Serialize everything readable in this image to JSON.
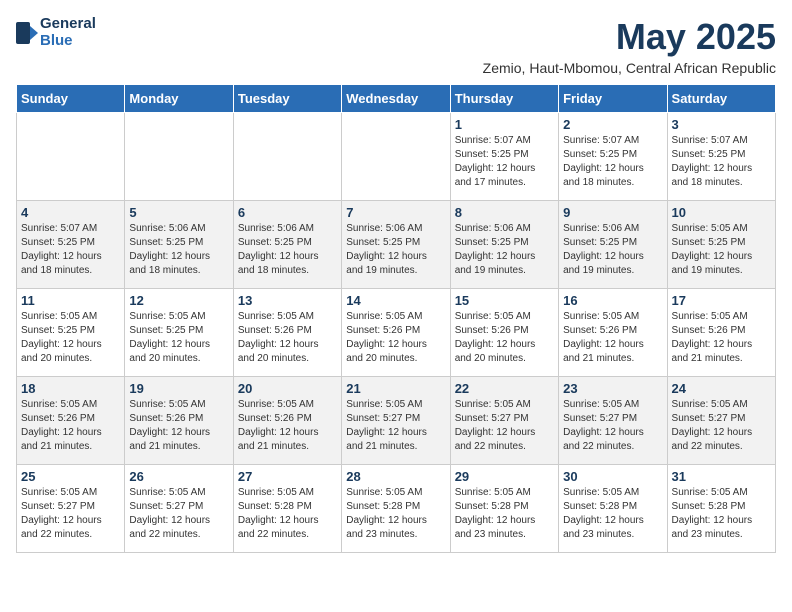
{
  "logo": {
    "line1": "General",
    "line2": "Blue"
  },
  "title": "May 2025",
  "subtitle": "Zemio, Haut-Mbomou, Central African Republic",
  "days_of_week": [
    "Sunday",
    "Monday",
    "Tuesday",
    "Wednesday",
    "Thursday",
    "Friday",
    "Saturday"
  ],
  "weeks": [
    [
      {
        "day": "",
        "info": ""
      },
      {
        "day": "",
        "info": ""
      },
      {
        "day": "",
        "info": ""
      },
      {
        "day": "",
        "info": ""
      },
      {
        "day": "1",
        "info": "Sunrise: 5:07 AM\nSunset: 5:25 PM\nDaylight: 12 hours\nand 17 minutes."
      },
      {
        "day": "2",
        "info": "Sunrise: 5:07 AM\nSunset: 5:25 PM\nDaylight: 12 hours\nand 18 minutes."
      },
      {
        "day": "3",
        "info": "Sunrise: 5:07 AM\nSunset: 5:25 PM\nDaylight: 12 hours\nand 18 minutes."
      }
    ],
    [
      {
        "day": "4",
        "info": "Sunrise: 5:07 AM\nSunset: 5:25 PM\nDaylight: 12 hours\nand 18 minutes."
      },
      {
        "day": "5",
        "info": "Sunrise: 5:06 AM\nSunset: 5:25 PM\nDaylight: 12 hours\nand 18 minutes."
      },
      {
        "day": "6",
        "info": "Sunrise: 5:06 AM\nSunset: 5:25 PM\nDaylight: 12 hours\nand 18 minutes."
      },
      {
        "day": "7",
        "info": "Sunrise: 5:06 AM\nSunset: 5:25 PM\nDaylight: 12 hours\nand 19 minutes."
      },
      {
        "day": "8",
        "info": "Sunrise: 5:06 AM\nSunset: 5:25 PM\nDaylight: 12 hours\nand 19 minutes."
      },
      {
        "day": "9",
        "info": "Sunrise: 5:06 AM\nSunset: 5:25 PM\nDaylight: 12 hours\nand 19 minutes."
      },
      {
        "day": "10",
        "info": "Sunrise: 5:05 AM\nSunset: 5:25 PM\nDaylight: 12 hours\nand 19 minutes."
      }
    ],
    [
      {
        "day": "11",
        "info": "Sunrise: 5:05 AM\nSunset: 5:25 PM\nDaylight: 12 hours\nand 20 minutes."
      },
      {
        "day": "12",
        "info": "Sunrise: 5:05 AM\nSunset: 5:25 PM\nDaylight: 12 hours\nand 20 minutes."
      },
      {
        "day": "13",
        "info": "Sunrise: 5:05 AM\nSunset: 5:26 PM\nDaylight: 12 hours\nand 20 minutes."
      },
      {
        "day": "14",
        "info": "Sunrise: 5:05 AM\nSunset: 5:26 PM\nDaylight: 12 hours\nand 20 minutes."
      },
      {
        "day": "15",
        "info": "Sunrise: 5:05 AM\nSunset: 5:26 PM\nDaylight: 12 hours\nand 20 minutes."
      },
      {
        "day": "16",
        "info": "Sunrise: 5:05 AM\nSunset: 5:26 PM\nDaylight: 12 hours\nand 21 minutes."
      },
      {
        "day": "17",
        "info": "Sunrise: 5:05 AM\nSunset: 5:26 PM\nDaylight: 12 hours\nand 21 minutes."
      }
    ],
    [
      {
        "day": "18",
        "info": "Sunrise: 5:05 AM\nSunset: 5:26 PM\nDaylight: 12 hours\nand 21 minutes."
      },
      {
        "day": "19",
        "info": "Sunrise: 5:05 AM\nSunset: 5:26 PM\nDaylight: 12 hours\nand 21 minutes."
      },
      {
        "day": "20",
        "info": "Sunrise: 5:05 AM\nSunset: 5:26 PM\nDaylight: 12 hours\nand 21 minutes."
      },
      {
        "day": "21",
        "info": "Sunrise: 5:05 AM\nSunset: 5:27 PM\nDaylight: 12 hours\nand 21 minutes."
      },
      {
        "day": "22",
        "info": "Sunrise: 5:05 AM\nSunset: 5:27 PM\nDaylight: 12 hours\nand 22 minutes."
      },
      {
        "day": "23",
        "info": "Sunrise: 5:05 AM\nSunset: 5:27 PM\nDaylight: 12 hours\nand 22 minutes."
      },
      {
        "day": "24",
        "info": "Sunrise: 5:05 AM\nSunset: 5:27 PM\nDaylight: 12 hours\nand 22 minutes."
      }
    ],
    [
      {
        "day": "25",
        "info": "Sunrise: 5:05 AM\nSunset: 5:27 PM\nDaylight: 12 hours\nand 22 minutes."
      },
      {
        "day": "26",
        "info": "Sunrise: 5:05 AM\nSunset: 5:27 PM\nDaylight: 12 hours\nand 22 minutes."
      },
      {
        "day": "27",
        "info": "Sunrise: 5:05 AM\nSunset: 5:28 PM\nDaylight: 12 hours\nand 22 minutes."
      },
      {
        "day": "28",
        "info": "Sunrise: 5:05 AM\nSunset: 5:28 PM\nDaylight: 12 hours\nand 23 minutes."
      },
      {
        "day": "29",
        "info": "Sunrise: 5:05 AM\nSunset: 5:28 PM\nDaylight: 12 hours\nand 23 minutes."
      },
      {
        "day": "30",
        "info": "Sunrise: 5:05 AM\nSunset: 5:28 PM\nDaylight: 12 hours\nand 23 minutes."
      },
      {
        "day": "31",
        "info": "Sunrise: 5:05 AM\nSunset: 5:28 PM\nDaylight: 12 hours\nand 23 minutes."
      }
    ]
  ]
}
